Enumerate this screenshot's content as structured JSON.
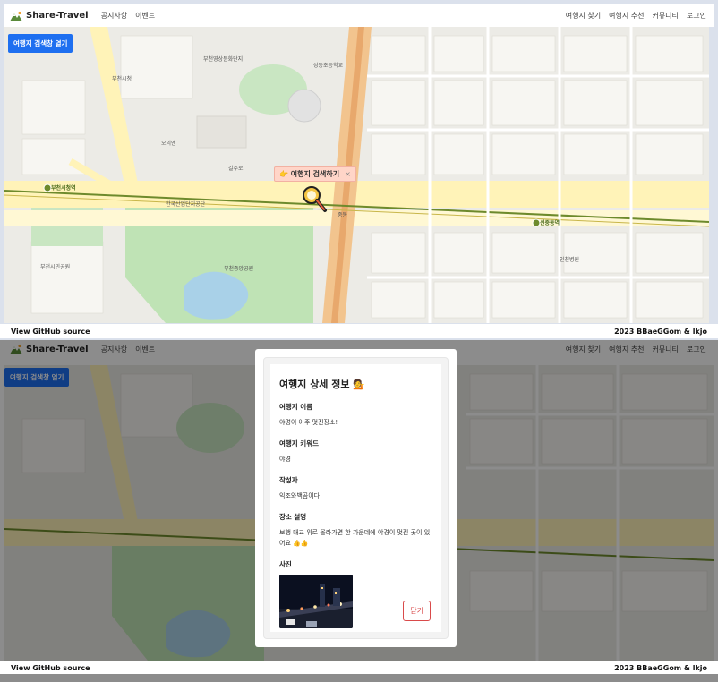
{
  "app": {
    "brand": "Share-Travel"
  },
  "nav": {
    "left": [
      "공지사항",
      "이벤트"
    ],
    "right": [
      "여행지 찾기",
      "여행지 추천",
      "커뮤니티",
      "로그인"
    ]
  },
  "map_labels": {
    "explore_button": "여행지 검색창 열기",
    "marker_tip": "👉 여행지 검색하기",
    "marker_close": "×",
    "station1": "부천시청역",
    "station2": "신중동역",
    "place1": "부천영상문화단지",
    "place2": "오리엔",
    "place3": "부천중앙공원",
    "place4": "성동초등학교",
    "place5": "부천시청",
    "place6": "길주로",
    "place7": "중동",
    "place8": "한국산업단지공단",
    "place9": "부천시민공원",
    "place10": "인천병원"
  },
  "footer": {
    "left": "View GitHub source",
    "right": "2023 BBaeGGom & lkjo"
  },
  "modal": {
    "title": "여행지 상세 정보 💁",
    "fields": [
      {
        "label": "여행지 이름",
        "value": "야경이 아주 멋진장소!"
      },
      {
        "label": "여행지 키워드",
        "value": "야경"
      },
      {
        "label": "작성자",
        "value": "익조와백곰이다"
      },
      {
        "label": "장소 설명",
        "value": "보행 대교 위로 올라가면 한 가운데에 야경이 멋진 곳이 있어요 👍👍"
      }
    ],
    "photo_label": "사진",
    "close_button": "닫기"
  }
}
